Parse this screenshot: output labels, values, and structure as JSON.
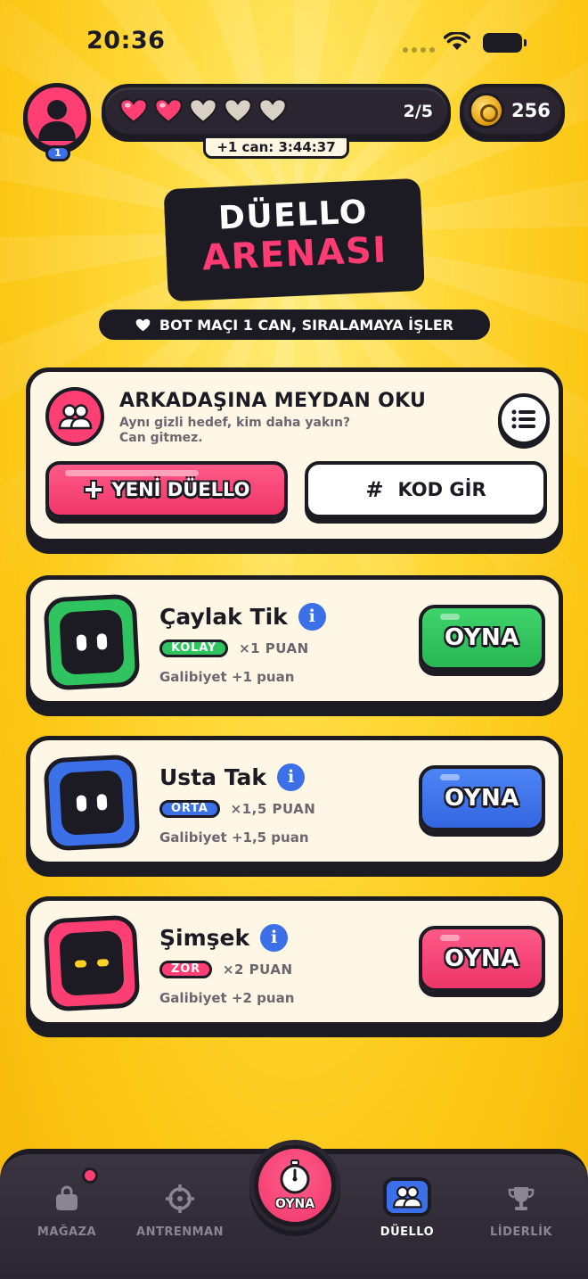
{
  "status_bar": {
    "time": "20:36"
  },
  "hud": {
    "level": "1",
    "hearts": {
      "filled": 2,
      "total": 5,
      "count_text": "2/5"
    },
    "timer_text": "+1 can: 3:44:37",
    "coins": "256"
  },
  "title": {
    "line1": "DÜELLO",
    "line2": "ARENASI"
  },
  "info_pill": {
    "icon": "heart-icon",
    "text": "BOT MAÇI 1 CAN, SIRALAMAYA İŞLER"
  },
  "challenge": {
    "title": "ARKADAŞINA MEYDAN OKU",
    "subtitle_line1": "Aynı gizli hedef, kim daha yakın?",
    "subtitle_line2": "Can gitmez.",
    "new_button": "YENİ DÜELLO",
    "code_button": "KOD GİR"
  },
  "bots": [
    {
      "name": "Çaylak Tik",
      "difficulty": "KOLAY",
      "multiplier": "×1 PUAN",
      "reward": "Galibiyet +1 puan",
      "play": "OYNA",
      "color": "#2fc45f",
      "tag_color": "#2fc45f",
      "btn_color": "#34c95e"
    },
    {
      "name": "Usta Tak",
      "difficulty": "ORTA",
      "multiplier": "×1,5 PUAN",
      "reward": "Galibiyet +1,5 puan",
      "play": "OYNA",
      "color": "#3b70e8",
      "tag_color": "#3b70e8",
      "btn_color": "#3f76ee"
    },
    {
      "name": "Şimşek",
      "difficulty": "ZOR",
      "multiplier": "×2 PUAN",
      "reward": "Galibiyet +2 puan",
      "play": "OYNA",
      "color": "#ff3f74",
      "tag_color": "#ff3f74",
      "btn_color": "#f83d70"
    }
  ],
  "nav": {
    "items": [
      {
        "label": "MAĞAZA",
        "icon": "bag-icon"
      },
      {
        "label": "ANTRENMAN",
        "icon": "crosshair-icon"
      },
      {
        "label": "OYNA",
        "icon": "stopwatch-icon"
      },
      {
        "label": "DÜELLO",
        "icon": "users-icon"
      },
      {
        "label": "LİDERLİK",
        "icon": "trophy-icon"
      }
    ]
  }
}
